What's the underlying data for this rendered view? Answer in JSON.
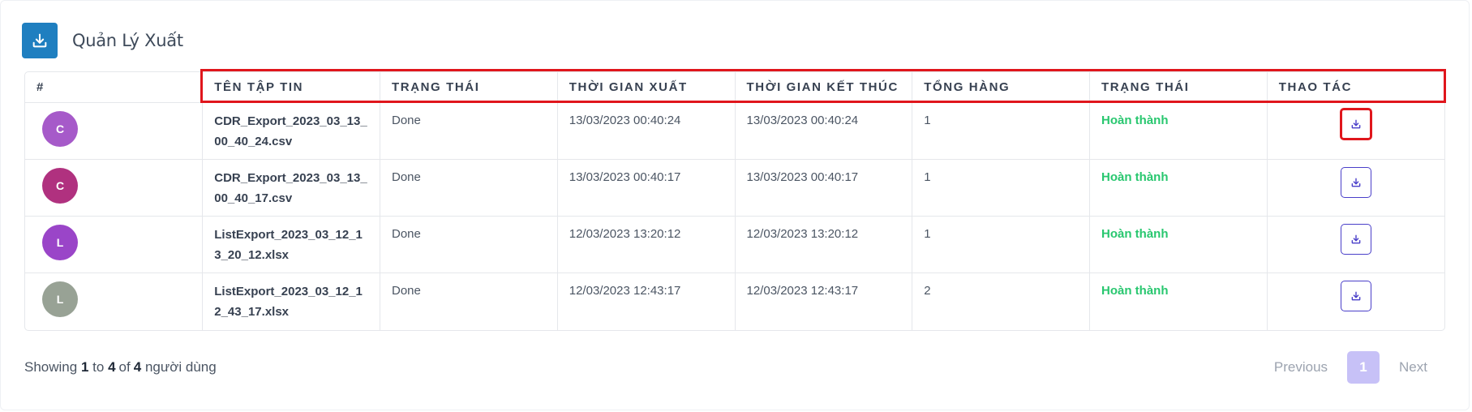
{
  "header": {
    "title": "Quản Lý Xuất",
    "icon": "download-icon"
  },
  "table": {
    "columns": [
      "#",
      "TÊN TẬP TIN",
      "TRẠNG THÁI",
      "THỜI GIAN XUẤT",
      "THỜI GIAN KẾT THÚC",
      "TỔNG HÀNG",
      "TRẠNG THÁI",
      "THAO TÁC"
    ],
    "rows": [
      {
        "avatar_letter": "C",
        "avatar_color": "#a65ac9",
        "filename": "CDR_Export_2023_03_13_00_40_24.csv",
        "state": "Done",
        "export_time": "13/03/2023 00:40:24",
        "end_time": "13/03/2023 00:40:24",
        "total": "1",
        "status": "Hoàn thành"
      },
      {
        "avatar_letter": "C",
        "avatar_color": "#b0317f",
        "filename": "CDR_Export_2023_03_13_00_40_17.csv",
        "state": "Done",
        "export_time": "13/03/2023 00:40:17",
        "end_time": "13/03/2023 00:40:17",
        "total": "1",
        "status": "Hoàn thành"
      },
      {
        "avatar_letter": "L",
        "avatar_color": "#9a45c8",
        "filename": "ListExport_2023_03_12_13_20_12.xlsx",
        "state": "Done",
        "export_time": "12/03/2023 13:20:12",
        "end_time": "12/03/2023 13:20:12",
        "total": "1",
        "status": "Hoàn thành"
      },
      {
        "avatar_letter": "L",
        "avatar_color": "#98a295",
        "filename": "ListExport_2023_03_12_12_43_17.xlsx",
        "state": "Done",
        "export_time": "12/03/2023 12:43:17",
        "end_time": "12/03/2023 12:43:17",
        "total": "2",
        "status": "Hoàn thành"
      }
    ]
  },
  "footer": {
    "showing_prefix": "Showing",
    "from": "1",
    "to_word": "to",
    "to": "4",
    "of_word": "of",
    "total": "4",
    "suffix": "người dùng",
    "prev": "Previous",
    "page": "1",
    "next": "Next"
  },
  "colors": {
    "accent": "#1f7fc0",
    "button_border": "#4a3fc9",
    "success": "#28c76f",
    "highlight": "#e0161c",
    "page_active": "#c7c1f7"
  }
}
